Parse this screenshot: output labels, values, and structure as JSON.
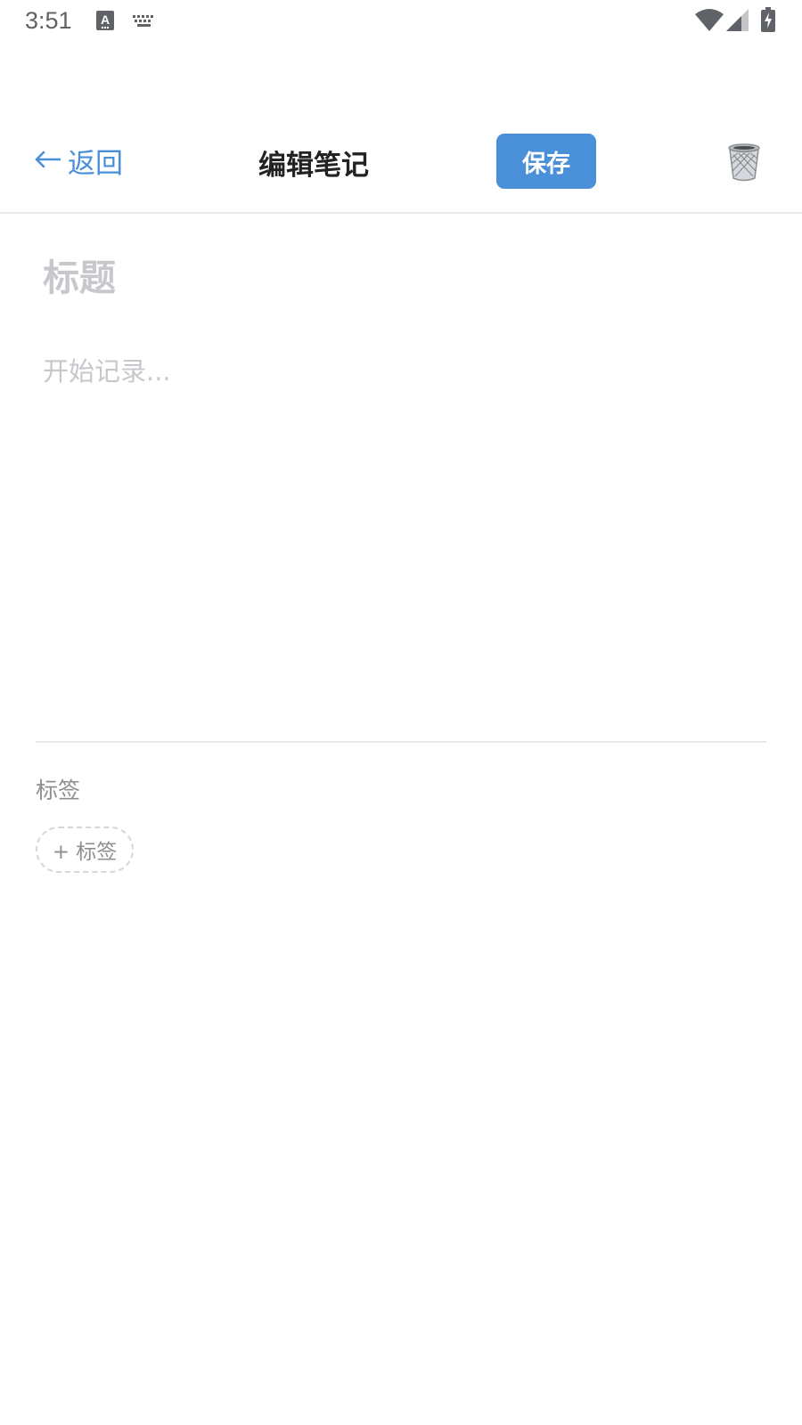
{
  "status_bar": {
    "time": "3:51",
    "icons": [
      "text-input-icon",
      "keyboard-icon",
      "wifi-icon",
      "signal-icon",
      "battery-charging-icon"
    ]
  },
  "header": {
    "back_label": "返回",
    "title": "编辑笔记",
    "save_label": "保存",
    "delete_icon": "trash-icon"
  },
  "editor": {
    "title_placeholder": "标题",
    "body_placeholder": "开始记录...",
    "title_value": "",
    "body_value": ""
  },
  "tags": {
    "label": "标签",
    "add_label": "+ 标签"
  },
  "colors": {
    "accent": "#4a90d9",
    "placeholder": "#c7c7cc",
    "secondary_text": "#8e8e93",
    "divider": "#e9e9ec"
  }
}
